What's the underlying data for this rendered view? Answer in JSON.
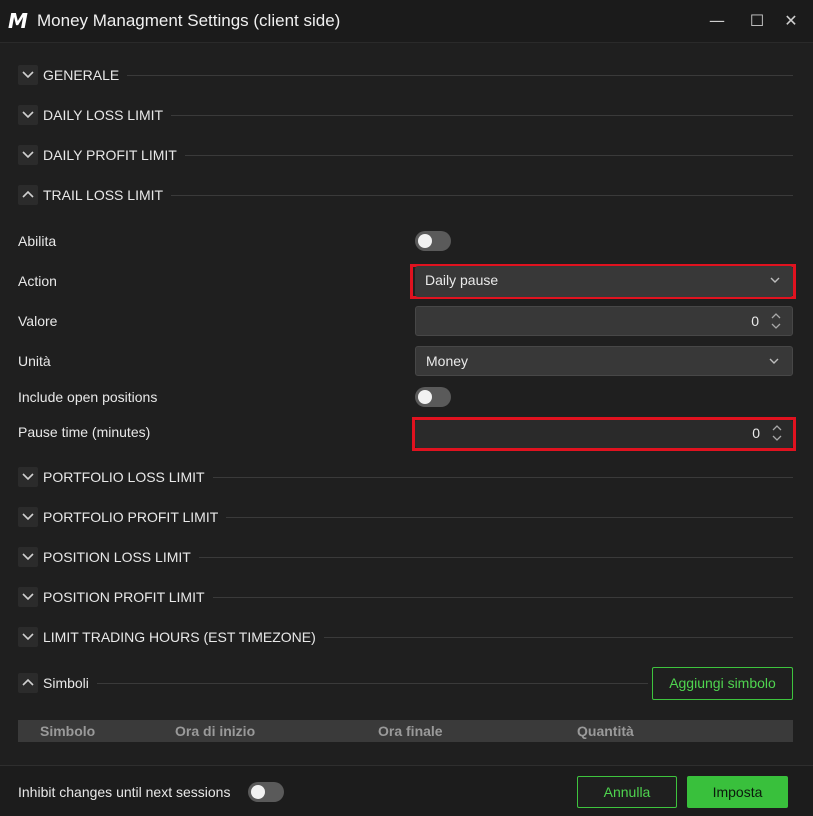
{
  "window": {
    "logo_text": "M",
    "title": "Money Managment Settings (client side)",
    "minimize_glyph": "—",
    "maximize_glyph": "☐",
    "close_glyph": "✕"
  },
  "sections": {
    "generale": "GENERALE",
    "daily_loss": "DAILY LOSS LIMIT",
    "daily_profit": "DAILY PROFIT LIMIT",
    "trail_loss": "TRAIL LOSS LIMIT",
    "portfolio_loss": "PORTFOLIO LOSS LIMIT",
    "portfolio_profit": "PORTFOLIO PROFIT LIMIT",
    "position_loss": "POSITION LOSS LIMIT",
    "position_profit": "POSITION PROFIT LIMIT",
    "trading_hours": "LIMIT TRADING HOURS (EST TIMEZONE)",
    "simboli": "Simboli"
  },
  "trail": {
    "abilita_label": "Abilita",
    "abilita_on": false,
    "action_label": "Action",
    "action_value": "Daily pause",
    "valore_label": "Valore",
    "valore_value": "0",
    "unita_label": "Unità",
    "unita_value": "Money",
    "include_label": "Include open positions",
    "include_on": false,
    "pause_label": "Pause time (minutes)",
    "pause_value": "0"
  },
  "simboli": {
    "add_button": "Aggiungi simbolo",
    "columns": [
      "Simbolo",
      "Ora di inizio",
      "Ora finale",
      "Quantità"
    ]
  },
  "footer": {
    "inhibit_label": "Inhibit changes until next sessions",
    "inhibit_on": false,
    "cancel_button": "Annulla",
    "apply_button": "Imposta"
  },
  "colors": {
    "highlight": "#e0121f",
    "accent_green": "#39c03c",
    "background": "#1f1f1f"
  }
}
